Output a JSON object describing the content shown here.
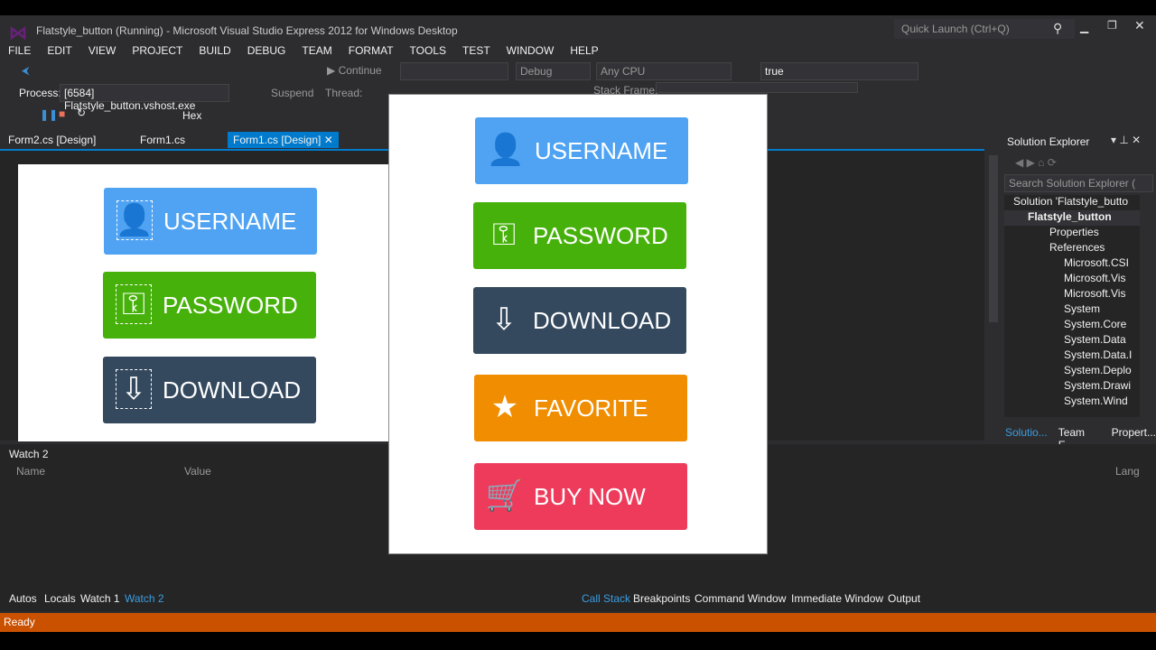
{
  "window": {
    "title": "Flatstyle_button (Running) - Microsoft Visual Studio Express 2012 for Windows Desktop",
    "quick_launch": "Quick Launch (Ctrl+Q)"
  },
  "menu": [
    "FILE",
    "EDIT",
    "VIEW",
    "PROJECT",
    "BUILD",
    "DEBUG",
    "TEAM",
    "FORMAT",
    "TOOLS",
    "TEST",
    "WINDOW",
    "HELP"
  ],
  "toolbar": {
    "continue": "Continue",
    "config": "Debug",
    "platform": "Any CPU",
    "value": "true",
    "process_label": "Process:",
    "process": "[6584] Flatstyle_button.vshost.exe",
    "suspend": "Suspend",
    "thread": "Thread:",
    "stack_frame": "Stack Frame:",
    "hex": "Hex"
  },
  "tabs": [
    "Form2.cs [Design]",
    "Form1.cs",
    "Form1.cs [Design]"
  ],
  "designer_buttons": [
    {
      "label": "USERNAME",
      "color": "#4fa3f2",
      "icon": "user-icon"
    },
    {
      "label": "PASSWORD",
      "color": "#47b10b",
      "icon": "key-icon"
    },
    {
      "label": "DOWNLOAD",
      "color": "#34495e",
      "icon": "cloud-download-icon"
    }
  ],
  "popup_buttons": [
    {
      "label": "USERNAME",
      "color": "#4fa3f2",
      "icon": "user-icon"
    },
    {
      "label": "PASSWORD",
      "color": "#47b10b",
      "icon": "key-icon"
    },
    {
      "label": "DOWNLOAD",
      "color": "#34495e",
      "icon": "cloud-download-icon"
    },
    {
      "label": "FAVORITE",
      "color": "#f08d00",
      "icon": "star-icon"
    },
    {
      "label": "BUY NOW",
      "color": "#ee3b5b",
      "icon": "cart-icon"
    }
  ],
  "solution_explorer": {
    "title": "Solution Explorer",
    "search": "Search Solution Explorer (",
    "items": [
      "Solution 'Flatstyle_butto",
      "Flatstyle_button",
      "Properties",
      "References",
      "Microsoft.CSI",
      "Microsoft.Vis",
      "Microsoft.Vis",
      "System",
      "System.Core",
      "System.Data",
      "System.Data.I",
      "System.Deplo",
      "System.Drawi",
      "System.Wind"
    ],
    "tabs": [
      "Solutio...",
      "Team E...",
      "Propert..."
    ]
  },
  "watch": {
    "title": "Watch 2",
    "columns": [
      "Name",
      "Value",
      "Lang"
    ],
    "tabs": [
      "Autos",
      "Locals",
      "Watch 1",
      "Watch 2"
    ]
  },
  "debug_tabs": [
    "Call Stack",
    "Breakpoints",
    "Command Window",
    "Immediate Window",
    "Output"
  ],
  "status": "Ready"
}
